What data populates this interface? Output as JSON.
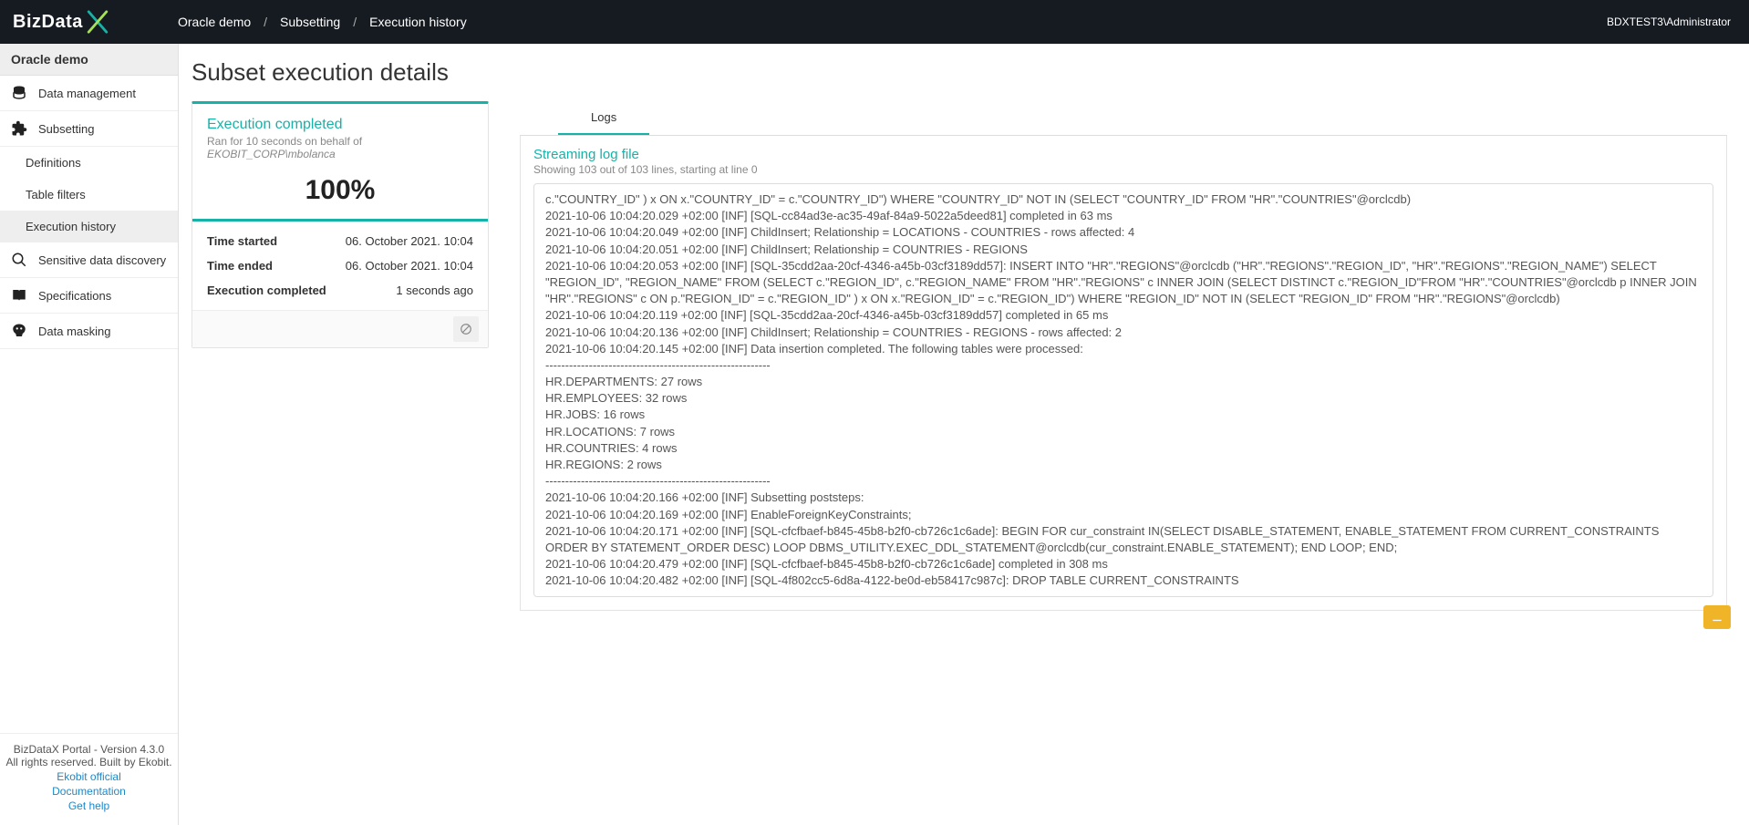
{
  "brand": "BizData",
  "user": "BDXTEST3\\Administrator",
  "breadcrumbs": [
    "Oracle demo",
    "Subsetting",
    "Execution history"
  ],
  "sidebar_title": "Oracle demo",
  "nav": {
    "data_management": "Data management",
    "subsetting": "Subsetting",
    "definitions": "Definitions",
    "table_filters": "Table filters",
    "execution_history": "Execution history",
    "discovery": "Sensitive data discovery",
    "specifications": "Specifications",
    "masking": "Data masking"
  },
  "footer": {
    "version": "BizDataX Portal - Version 4.3.0",
    "rights": "All rights reserved. Built by Ekobit.",
    "links": [
      "Ekobit official",
      "Documentation",
      "Get help"
    ]
  },
  "page_title": "Subset execution details",
  "exec_card": {
    "title": "Execution completed",
    "subtitle_prefix": "Ran for 10 seconds on behalf of ",
    "subtitle_user": "EKOBIT_CORP\\mbolanca",
    "percent": "100%",
    "time_started_k": "Time started",
    "time_started_v": "06. October 2021. 10:04",
    "time_ended_k": "Time ended",
    "time_ended_v": "06. October 2021. 10:04",
    "completed_k": "Execution completed",
    "completed_v": "1 seconds ago"
  },
  "tabs": {
    "logs": "Logs"
  },
  "log_header": {
    "title": "Streaming log file",
    "sub": "Showing 103 out of 103 lines, starting at line 0"
  },
  "log_lines": [
    "c.\"COUNTRY_ID\" ) x ON x.\"COUNTRY_ID\" = c.\"COUNTRY_ID\") WHERE \"COUNTRY_ID\" NOT IN (SELECT \"COUNTRY_ID\" FROM \"HR\".\"COUNTRIES\"@orclcdb)",
    "2021-10-06 10:04:20.029 +02:00 [INF] [SQL-cc84ad3e-ac35-49af-84a9-5022a5deed81] completed in 63 ms",
    "2021-10-06 10:04:20.049 +02:00 [INF] ChildInsert; Relationship = LOCATIONS - COUNTRIES - rows affected: 4",
    "2021-10-06 10:04:20.051 +02:00 [INF] ChildInsert; Relationship = COUNTRIES - REGIONS",
    "2021-10-06 10:04:20.053 +02:00 [INF] [SQL-35cdd2aa-20cf-4346-a45b-03cf3189dd57]: INSERT INTO \"HR\".\"REGIONS\"@orclcdb (\"HR\".\"REGIONS\".\"REGION_ID\", \"HR\".\"REGIONS\".\"REGION_NAME\") SELECT \"REGION_ID\", \"REGION_NAME\" FROM (SELECT c.\"REGION_ID\", c.\"REGION_NAME\" FROM \"HR\".\"REGIONS\" c INNER JOIN (SELECT DISTINCT c.\"REGION_ID\"FROM \"HR\".\"COUNTRIES\"@orclcdb p INNER JOIN \"HR\".\"REGIONS\" c ON p.\"REGION_ID\" = c.\"REGION_ID\" ) x ON x.\"REGION_ID\" = c.\"REGION_ID\") WHERE \"REGION_ID\" NOT IN (SELECT \"REGION_ID\" FROM \"HR\".\"REGIONS\"@orclcdb)",
    "2021-10-06 10:04:20.119 +02:00 [INF] [SQL-35cdd2aa-20cf-4346-a45b-03cf3189dd57] completed in 65 ms",
    "2021-10-06 10:04:20.136 +02:00 [INF] ChildInsert; Relationship = COUNTRIES - REGIONS - rows affected: 2",
    "2021-10-06 10:04:20.145 +02:00 [INF] Data insertion completed. The following tables were processed:",
    "---------------------------------------------------------",
    "HR.DEPARTMENTS: 27 rows",
    "HR.EMPLOYEES: 32 rows",
    "HR.JOBS: 16 rows",
    "HR.LOCATIONS: 7 rows",
    "HR.COUNTRIES: 4 rows",
    "HR.REGIONS: 2 rows",
    "---------------------------------------------------------",
    "2021-10-06 10:04:20.166 +02:00 [INF] Subsetting poststeps:",
    "2021-10-06 10:04:20.169 +02:00 [INF] EnableForeignKeyConstraints;",
    "2021-10-06 10:04:20.171 +02:00 [INF] [SQL-cfcfbaef-b845-45b8-b2f0-cb726c1c6ade]: BEGIN FOR cur_constraint IN(SELECT DISABLE_STATEMENT, ENABLE_STATEMENT FROM CURRENT_CONSTRAINTS ORDER BY STATEMENT_ORDER DESC) LOOP DBMS_UTILITY.EXEC_DDL_STATEMENT@orclcdb(cur_constraint.ENABLE_STATEMENT); END LOOP; END;",
    "2021-10-06 10:04:20.479 +02:00 [INF] [SQL-cfcfbaef-b845-45b8-b2f0-cb726c1c6ade] completed in 308 ms",
    "2021-10-06 10:04:20.482 +02:00 [INF] [SQL-4f802cc5-6d8a-4122-be0d-eb58417c987c]: DROP TABLE CURRENT_CONSTRAINTS"
  ]
}
